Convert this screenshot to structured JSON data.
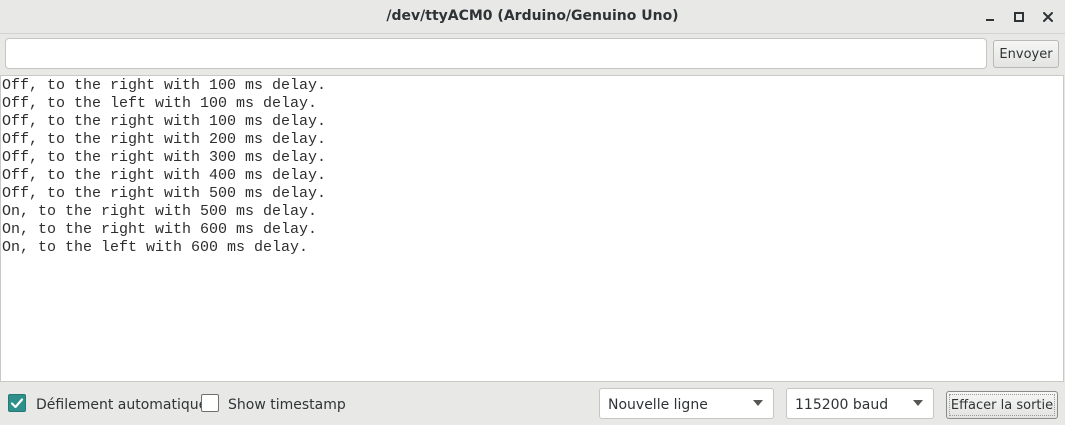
{
  "window": {
    "title": "/dev/ttyACM0 (Arduino/Genuino Uno)"
  },
  "send": {
    "input_value": "",
    "button_label": "Envoyer"
  },
  "output": {
    "lines": [
      "Off, to the right with 100 ms delay.",
      "Off, to the left with 100 ms delay.",
      "Off, to the right with 100 ms delay.",
      "Off, to the right with 200 ms delay.",
      "Off, to the right with 300 ms delay.",
      "Off, to the right with 400 ms delay.",
      "Off, to the right with 500 ms delay.",
      "On, to the right with 500 ms delay.",
      "On, to the right with 600 ms delay.",
      "On, to the left with 600 ms delay."
    ]
  },
  "status": {
    "autoscroll": {
      "label": "Défilement automatique",
      "checked": true
    },
    "timestamp": {
      "label": "Show timestamp",
      "checked": false
    },
    "line_ending": {
      "selected": "Nouvelle ligne"
    },
    "baud_rate": {
      "selected": "115200 baud"
    },
    "clear_button_label": "Effacer la sortie"
  },
  "icons": {
    "minimize": "minimize-icon",
    "maximize": "maximize-icon",
    "close": "close-icon",
    "check": "checkmark-icon",
    "dropdown": "chevron-down-icon"
  },
  "colors": {
    "accent": "#2f8f8a",
    "window_bg": "#e8e8e7",
    "output_bg": "#ffffff"
  }
}
